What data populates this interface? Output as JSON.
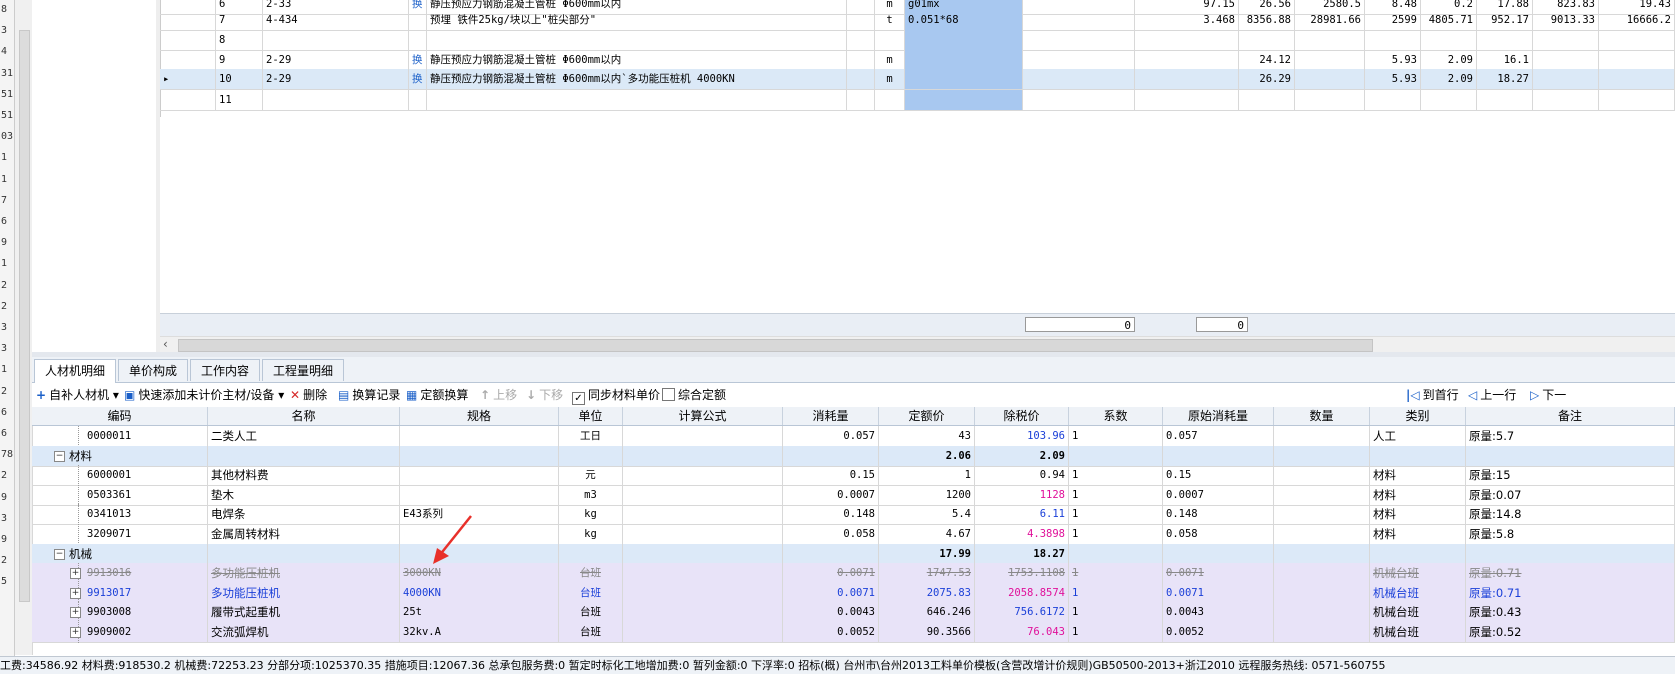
{
  "left_gutter": [
    "8",
    "3",
    "4",
    "31",
    "51",
    "51",
    "03",
    "1",
    "1",
    "7",
    "6",
    "9",
    "1",
    "2",
    "2",
    "3",
    "3",
    "1",
    "2",
    "6",
    "6",
    "78",
    "2",
    "9",
    "3",
    "9",
    "2",
    "5"
  ],
  "top_grid": {
    "rows": [
      {
        "seq": "6",
        "code": "2-33",
        "huan": "换",
        "name": "静压预应力钢筋混凝土管桩 Φ600mm以内",
        "unit": "m",
        "formula": "g01mx",
        "c1": "97.15",
        "c2": "26.56",
        "c3": "2580.5",
        "c4": "8.48",
        "c5": "0.2",
        "c6": "17.88",
        "c7": "823.83",
        "c8": "19.43"
      },
      {
        "seq": "7",
        "code": "4-434",
        "huan": "",
        "name": "预埋 铁件25kg/块以上\"桩尖部分\"",
        "unit": "t",
        "formula": "0.051*68",
        "c1": "3.468",
        "c2": "8356.88",
        "c3": "28981.66",
        "c4": "2599",
        "c5": "4805.71",
        "c6": "952.17",
        "c7": "9013.33",
        "c8": "16666.2"
      },
      {
        "seq": "8",
        "code": "",
        "huan": "",
        "name": "",
        "unit": "",
        "formula": "",
        "c1": "",
        "c2": "",
        "c3": "",
        "c4": "",
        "c5": "",
        "c6": "",
        "c7": "",
        "c8": ""
      },
      {
        "seq": "9",
        "code": "2-29",
        "huan": "换",
        "name": "静压预应力钢筋混凝土管桩 Φ600mm以内",
        "unit": "m",
        "formula": "",
        "c1": "",
        "c2": "24.12",
        "c3": "",
        "c4": "5.93",
        "c5": "2.09",
        "c6": "16.1",
        "c7": "",
        "c8": ""
      },
      {
        "seq": "10",
        "code": "2-29",
        "huan": "换",
        "name": "静压预应力钢筋混凝土管桩 Φ600mm以内`多功能压桩机 4000KN",
        "unit": "m",
        "formula": "",
        "c1": "",
        "c2": "26.29",
        "c3": "",
        "c4": "5.93",
        "c5": "2.09",
        "c6": "18.27",
        "c7": "",
        "c8": ""
      },
      {
        "seq": "11",
        "code": "",
        "huan": "",
        "name": "",
        "unit": "",
        "formula": "",
        "c1": "",
        "c2": "",
        "c3": "",
        "c4": "",
        "c5": "",
        "c6": "",
        "c7": "",
        "c8": ""
      }
    ],
    "footer_values": [
      "0",
      "0"
    ]
  },
  "tabs": [
    "人材机明细",
    "单价构成",
    "工作内容",
    "工程量明细"
  ],
  "toolbar": {
    "add": "自补人材机",
    "quick_add": "快速添加未计价主材/设备",
    "delete": "删除",
    "record": "换算记录",
    "quota": "定额换算",
    "up": "上移",
    "down": "下移",
    "sync": "同步材料单价",
    "combined": "综合定额",
    "first": "到首行",
    "prev": "上一行",
    "next": "下一"
  },
  "bottom_grid": {
    "headers": [
      "编码",
      "名称",
      "规格",
      "单位",
      "计算公式",
      "消耗量",
      "定额价",
      "除税价",
      "系数",
      "原始消耗量",
      "数量",
      "类别",
      "备注"
    ],
    "rows": [
      {
        "type": "item",
        "code": "0000011",
        "name": "二类人工",
        "spec": "",
        "unit": "工日",
        "formula": "",
        "qty": "0.057",
        "price": "43",
        "tax": "103.96",
        "taxcolor": "blue",
        "coef": "1",
        "orig": "0.057",
        "count": "",
        "cat": "人工",
        "note": "原量:5.7"
      },
      {
        "type": "group",
        "code": "材料",
        "price": "2.06",
        "tax": "2.09"
      },
      {
        "type": "item",
        "code": "6000001",
        "name": "其他材料费",
        "spec": "",
        "unit": "元",
        "formula": "",
        "qty": "0.15",
        "price": "1",
        "tax": "0.94",
        "taxcolor": "",
        "coef": "1",
        "orig": "0.15",
        "count": "",
        "cat": "材料",
        "note": "原量:15"
      },
      {
        "type": "item",
        "code": "0503361",
        "name": "垫木",
        "spec": "",
        "unit": "m3",
        "formula": "",
        "qty": "0.0007",
        "price": "1200",
        "tax": "1128",
        "taxcolor": "mag",
        "coef": "1",
        "orig": "0.0007",
        "count": "",
        "cat": "材料",
        "note": "原量:0.07"
      },
      {
        "type": "item",
        "code": "0341013",
        "name": "电焊条",
        "spec": "E43系列",
        "unit": "kg",
        "formula": "",
        "qty": "0.148",
        "price": "5.4",
        "tax": "6.11",
        "taxcolor": "blue",
        "coef": "1",
        "orig": "0.148",
        "count": "",
        "cat": "材料",
        "note": "原量:14.8"
      },
      {
        "type": "item",
        "code": "3209071",
        "name": "金属周转材料",
        "spec": "",
        "unit": "kg",
        "formula": "",
        "qty": "0.058",
        "price": "4.67",
        "tax": "4.3898",
        "taxcolor": "mag",
        "coef": "1",
        "orig": "0.058",
        "count": "",
        "cat": "材料",
        "note": "原量:5.8"
      },
      {
        "type": "group",
        "code": "机械",
        "price": "17.99",
        "tax": "18.27"
      },
      {
        "type": "mach",
        "style": "strike",
        "code": "9913016",
        "name": "多功能压桩机",
        "spec": "3000KN",
        "unit": "台班",
        "formula": "",
        "qty": "0.0071",
        "price": "1747.53",
        "tax": "1753.1108",
        "taxcolor": "",
        "coef": "1",
        "orig": "0.0071",
        "count": "",
        "cat": "机械台班",
        "note": "原量:0.71"
      },
      {
        "type": "mach",
        "style": "blue",
        "code": "9913017",
        "name": "多功能压桩机",
        "spec": "4000KN",
        "unit": "台班",
        "formula": "",
        "qty": "0.0071",
        "price": "2075.83",
        "tax": "2058.8574",
        "taxcolor": "mag",
        "coef": "1",
        "orig": "0.0071",
        "count": "",
        "cat": "机械台班",
        "note": "原量:0.71"
      },
      {
        "type": "mach",
        "style": "",
        "code": "9903008",
        "name": "履带式起重机",
        "spec": "25t",
        "unit": "台班",
        "formula": "",
        "qty": "0.0043",
        "price": "646.246",
        "tax": "756.6172",
        "taxcolor": "blue",
        "coef": "1",
        "orig": "0.0043",
        "count": "",
        "cat": "机械台班",
        "note": "原量:0.43"
      },
      {
        "type": "mach",
        "style": "",
        "code": "9909002",
        "name": "交流弧焊机",
        "spec": "32kv.A",
        "unit": "台班",
        "formula": "",
        "qty": "0.0052",
        "price": "90.3566",
        "tax": "76.043",
        "taxcolor": "mag",
        "coef": "1",
        "orig": "0.0052",
        "count": "",
        "cat": "机械台班",
        "note": "原量:0.52"
      }
    ]
  },
  "status_bar": "工费:34586.92 材料费:918530.2 机械费:72253.23 分部分项:1025370.35 措施项目:12067.36 总承包服务费:0 暂定时标化工地增加费:0 暂列金额:0 下浮率:0         招标(概)    台州市\\台州2013工料单价模板(含营改增计价规则)GB50500-2013+浙江2010  远程服务热线: 0571-560755",
  "colors": {
    "accent_blue": "#a8c8f0",
    "selected_row": "#dbe9f7",
    "group_row": "#dce9f8",
    "purple_row": "#e8e3f8",
    "magenta": "#e0109a",
    "blue_text": "#1a3fd8",
    "arrow": "#e8302a"
  }
}
